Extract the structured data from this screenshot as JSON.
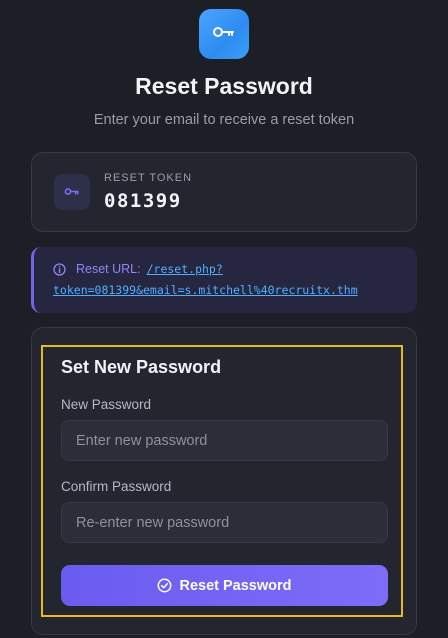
{
  "header": {
    "logo_icon": "key-icon",
    "title": "Reset Password",
    "subtitle": "Enter your email to receive a reset token"
  },
  "token": {
    "icon": "key-icon",
    "label": "RESET TOKEN",
    "value": "081399"
  },
  "reset_url": {
    "icon": "info-icon",
    "label": "Reset URL:",
    "link_line1": "/reset.php?",
    "link_line2": "token=081399&email=s.mitchell%40recruitx.thm"
  },
  "form": {
    "title": "Set New Password",
    "new_password": {
      "label": "New Password",
      "placeholder": "Enter new password",
      "value": ""
    },
    "confirm_password": {
      "label": "Confirm Password",
      "placeholder": "Re-enter new password",
      "value": ""
    },
    "submit": {
      "icon": "check-circle-icon",
      "label": "Reset Password"
    }
  },
  "colors": {
    "background": "#1d1f27",
    "card": "#23252f",
    "accent": "#7163f0",
    "link": "#4fb0ff",
    "highlight": "#e5b922"
  }
}
